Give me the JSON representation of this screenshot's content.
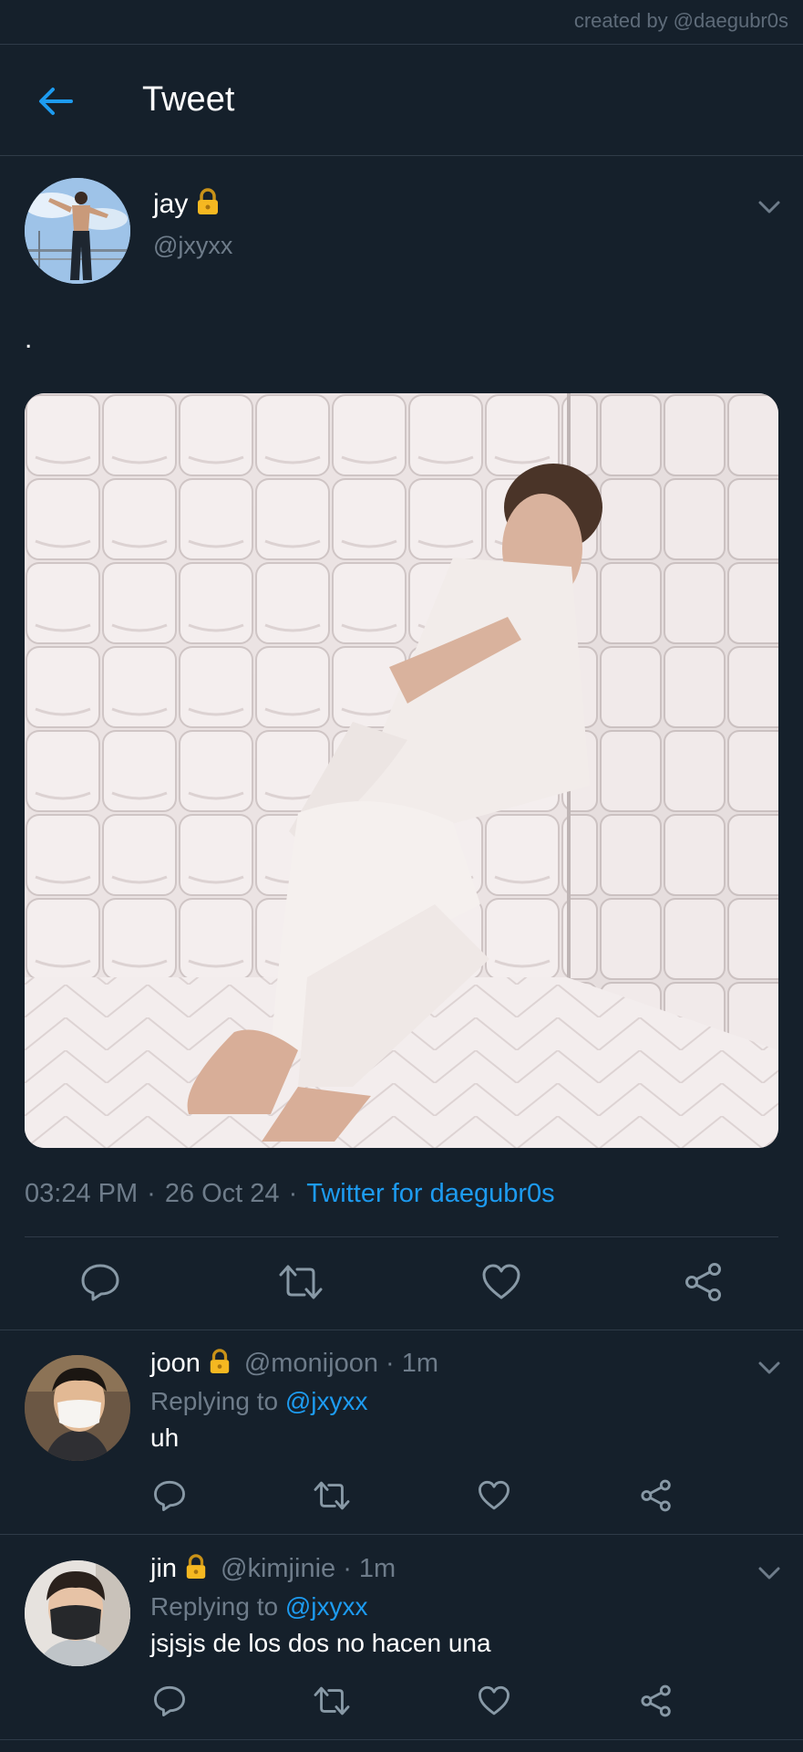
{
  "credit": "created by @daegubr0s",
  "header": {
    "title": "Tweet"
  },
  "tweet": {
    "name": "jay",
    "handle": "@jxyxx",
    "text": ".",
    "time": "03:24 PM",
    "date": "26 Oct 24",
    "separator": "·",
    "source": "Twitter for daegubr0s"
  },
  "replies": [
    {
      "name": "joon",
      "handle": "@monijoon",
      "time": "· 1m",
      "replying_prefix": "Replying to ",
      "replying_to": "@jxyxx",
      "text": "uh"
    },
    {
      "name": "jin",
      "handle": "@kimjinie",
      "time": "· 1m",
      "replying_prefix": "Replying to ",
      "replying_to": "@jxyxx",
      "text": "jsjsjs de los dos no hacen una"
    }
  ],
  "colors": {
    "background": "#15202b",
    "accent": "#1d9bf0",
    "muted": "#6e7c8a",
    "divider": "#2f3b48",
    "lock": "#f5b821"
  },
  "icons": [
    "back-arrow-icon",
    "lock-icon",
    "chevron-down-icon",
    "reply-icon",
    "retweet-icon",
    "like-icon",
    "share-icon"
  ]
}
